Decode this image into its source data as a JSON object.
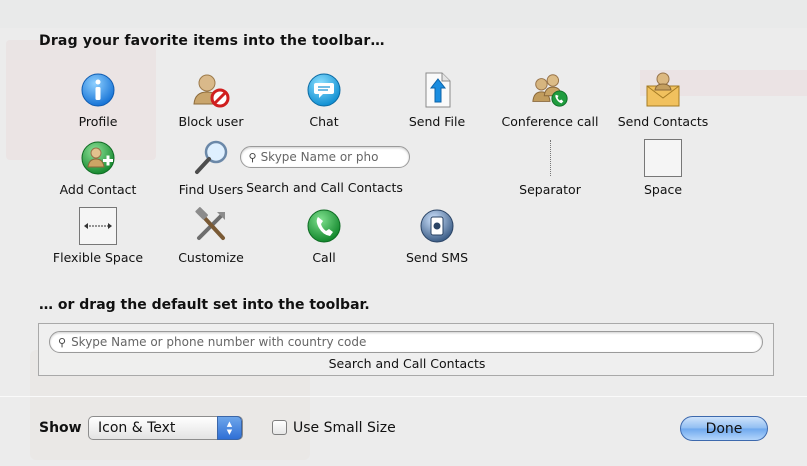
{
  "sheet": {
    "title": "Drag your favorite items into the toolbar…",
    "default_title": "… or drag the default set into the toolbar."
  },
  "items": {
    "profile": "Profile",
    "block_user": "Block user",
    "chat": "Chat",
    "send_file": "Send File",
    "conference_call": "Conference call",
    "send_contacts": "Send Contacts",
    "add_contact": "Add Contact",
    "find_users": "Find Users",
    "search_and_call": "Search and Call Contacts",
    "search_placeholder": "Skype Name or pho",
    "separator": "Separator",
    "space": "Space",
    "flexible_space": "Flexible Space",
    "customize": "Customize",
    "call": "Call",
    "send_sms": "Send SMS"
  },
  "default_set": {
    "search_placeholder": "Skype Name or phone number with country code",
    "label": "Search and Call Contacts"
  },
  "footer": {
    "show_label": "Show",
    "show_selected": "Icon & Text",
    "small_size_label": "Use Small Size",
    "small_size_checked": false,
    "done_label": "Done"
  },
  "colors": {
    "skype_blue": "#1fa7e6",
    "call_green": "#1d9a3c",
    "done_blue": "#8fbdf2"
  }
}
